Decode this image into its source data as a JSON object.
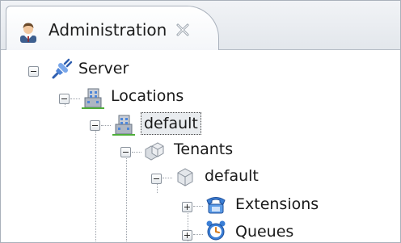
{
  "tab": {
    "title": "Administration",
    "icon": "admin-user-icon",
    "close_icon": "close-icon"
  },
  "tree": {
    "server": {
      "label": "Server",
      "icon": "server-plug-icon",
      "expanded": true
    },
    "locations": {
      "label": "Locations",
      "icon": "building-icon",
      "expanded": true
    },
    "location_default": {
      "label": "default",
      "icon": "building-icon",
      "expanded": true,
      "selected": true
    },
    "tenants": {
      "label": "Tenants",
      "icon": "cube-group-icon",
      "expanded": true
    },
    "tenant_default": {
      "label": "default",
      "icon": "cube-icon",
      "expanded": true
    },
    "extensions": {
      "label": "Extensions",
      "icon": "phone-icon",
      "expanded": false
    },
    "queues": {
      "label": "Queues",
      "icon": "alarm-clock-icon",
      "expanded": false
    }
  }
}
